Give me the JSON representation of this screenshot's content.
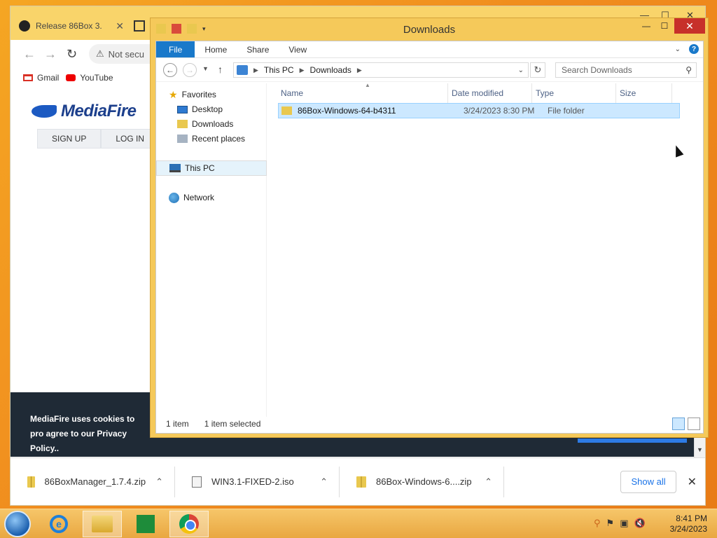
{
  "chrome": {
    "tab_title": "Release 86Box 3.",
    "address_prefix": "Not secu",
    "bookmarks": [
      {
        "label": "Gmail"
      },
      {
        "label": "YouTube"
      }
    ],
    "site": {
      "logo_text": "MediaFire",
      "signup": "SIGN UP",
      "login": "LOG IN",
      "cookie_text": "MediaFire uses cookies to pro agree to our Privacy Policy.."
    },
    "downloads": [
      {
        "name": "86BoxManager_1.7.4.zip",
        "icon": "zip-icon"
      },
      {
        "name": "WIN3.1-FIXED-2.iso",
        "icon": "iso-icon"
      },
      {
        "name": "86Box-Windows-6....zip",
        "icon": "zip-icon"
      }
    ],
    "show_all": "Show all"
  },
  "explorer": {
    "title": "Downloads",
    "ribbon_tabs": {
      "file": "File",
      "home": "Home",
      "share": "Share",
      "view": "View"
    },
    "breadcrumb": {
      "root": "This PC",
      "current": "Downloads"
    },
    "search_placeholder": "Search Downloads",
    "nav": {
      "favorites": "Favorites",
      "desktop": "Desktop",
      "downloads": "Downloads",
      "recent": "Recent places",
      "this_pc": "This PC",
      "network": "Network"
    },
    "columns": {
      "name": "Name",
      "date": "Date modified",
      "type": "Type",
      "size": "Size"
    },
    "files": [
      {
        "name": "86Box-Windows-64-b4311",
        "date": "3/24/2023 8:30 PM",
        "type": "File folder",
        "size": ""
      }
    ],
    "status": {
      "count": "1 item",
      "selected": "1 item selected"
    }
  },
  "taskbar": {
    "time": "8:41 PM",
    "date": "3/24/2023"
  }
}
